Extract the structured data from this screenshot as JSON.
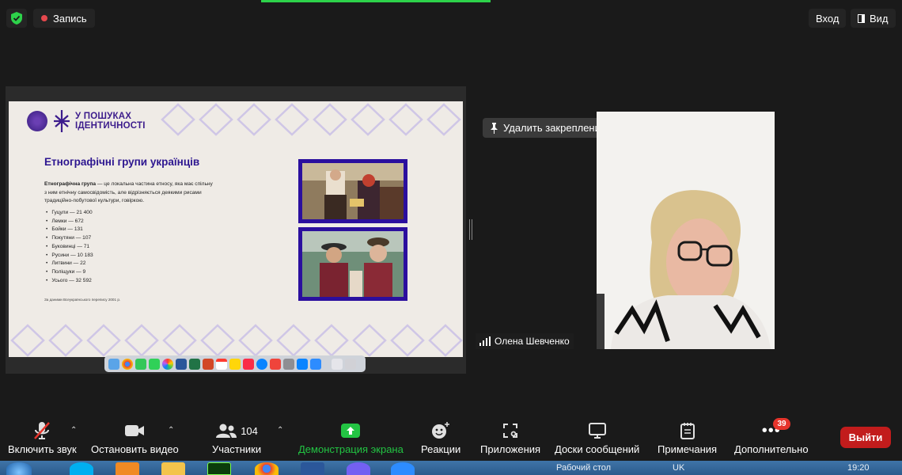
{
  "topbar": {
    "recording_label": "Запись",
    "signin_label": "Вход",
    "view_label": "Вид"
  },
  "slide": {
    "logo_text_line1": "У ПОШУКАХ",
    "logo_text_line2": "ІДЕНТИЧНОСТІ",
    "title": "Етнографічні групи українців",
    "definition_term": "Етнографічна група",
    "definition_line1": " — це локальна частина етносу, яка має спільну",
    "definition_line2": "з ним етнічну самосвідомість, але відрізняється деякими рисами",
    "definition_line3": "традиційно-побутової культури, говіркою.",
    "groups": [
      "Гуцули — 21 400",
      "Лемки — 672",
      "Бойки — 131",
      "Покутяни — 107",
      "Буковинці — 71",
      "Русини — 10 183",
      "Литвини — 22",
      "Поліщуки — 9",
      "Усього — 32 592"
    ],
    "footnote": "За даними Всеукраїнського перепису 2001 р."
  },
  "video": {
    "unpin_label": "Удалить закрепление",
    "participant_name": "Олена Шевченко"
  },
  "toolbar": {
    "unmute_label": "Включить звук",
    "stop_video_label": "Остановить видео",
    "participants_label": "Участники",
    "participants_count": "104",
    "share_label": "Демонстрация экрана",
    "reactions_label": "Реакции",
    "apps_label": "Приложения",
    "whiteboards_label": "Доски сообщений",
    "notes_label": "Примечания",
    "more_label": "Дополнительно",
    "more_badge": "39",
    "leave_label": "Выйти"
  },
  "taskbar": {
    "desktop_label": "Рабочий стол",
    "lang": "UK",
    "time": "19:20"
  },
  "colors": {
    "share_green": "#23c443",
    "leave_red": "#c21c1c",
    "slide_purple": "#2d1690"
  }
}
